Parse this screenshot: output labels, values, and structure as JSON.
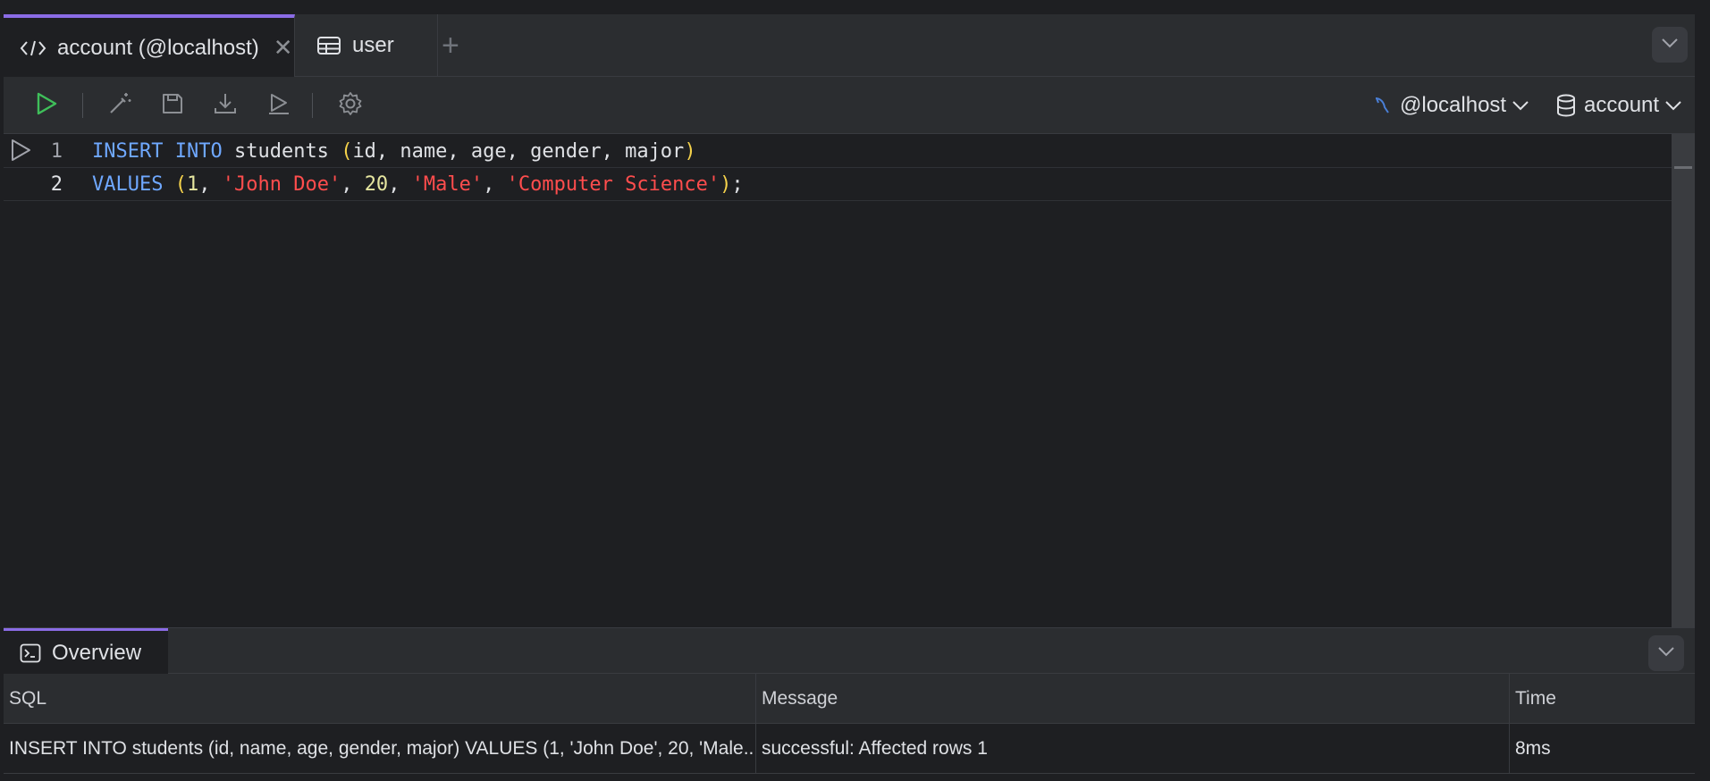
{
  "tabs": [
    {
      "icon": "code-icon",
      "label": "account (@localhost)",
      "closable": true,
      "active": true
    },
    {
      "icon": "table-icon",
      "label": "user",
      "closable": false,
      "active": false
    }
  ],
  "tab_add_symbol": "+",
  "tab_close_symbol": "✕",
  "toolbar": {
    "buttons": [
      "run-icon",
      "magic-wand-icon",
      "save-icon",
      "download-icon",
      "run-selection-icon",
      "settings-icon"
    ],
    "connection_label": "@localhost",
    "database_label": "account"
  },
  "editor": {
    "lines": [
      {
        "number": "1"
      },
      {
        "number": "2"
      }
    ],
    "tokens": {
      "l1_kw1": "INSERT",
      "l1_kw2": "INTO",
      "l1_table": "students",
      "l1_open": "(",
      "l1_cols": "id, name, age, gender, major",
      "l1_close": ")",
      "l2_kw": "VALUES",
      "l2_open": "(",
      "l2_v1": "1",
      "l2_c1": ", ",
      "l2_v2": "'John Doe'",
      "l2_c2": ", ",
      "l2_v3": "20",
      "l2_c3": ", ",
      "l2_v4": "'Male'",
      "l2_c4": ", ",
      "l2_v5": "'Computer Science'",
      "l2_close": ")",
      "l2_semi": ";"
    }
  },
  "result": {
    "tab_label": "Overview",
    "columns": [
      "SQL",
      "Message",
      "Time"
    ],
    "rows": [
      {
        "sql": "INSERT INTO students (id, name, age, gender, major) VALUES (1, 'John Doe', 20, 'Male...",
        "message": "successful: Affected rows 1",
        "time": "8ms"
      }
    ]
  },
  "colors": {
    "accent": "#8b6ce6",
    "keyword": "#6fa8ff",
    "string": "#ff4d4d",
    "run_green": "#3fbf5a",
    "background": "#1e1f22",
    "panel": "#2b2d30"
  }
}
